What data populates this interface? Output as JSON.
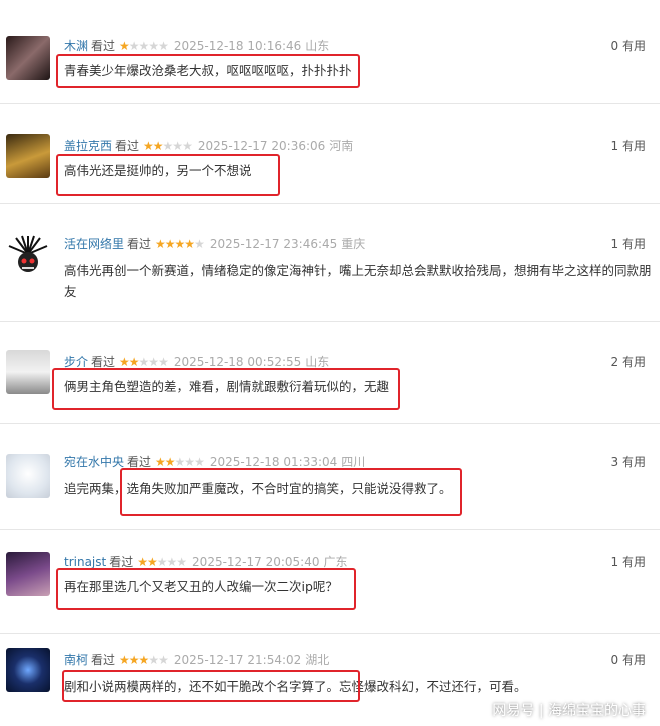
{
  "reviews": [
    {
      "user": "木渊",
      "status": "看过",
      "stars": 1,
      "time": "2025-12-18 10:16:46",
      "location": "山东",
      "useful": "0 有用",
      "content": "青春美少年爆改沧桑老大叔，呕呕呕呕呕，扑扑扑扑"
    },
    {
      "user": "盖拉克西",
      "status": "看过",
      "stars": 2,
      "time": "2025-12-17 20:36:06",
      "location": "河南",
      "useful": "1 有用",
      "content": "高伟光还是挺帅的，另一个不想说"
    },
    {
      "user": "活在网络里",
      "status": "看过",
      "stars": 4,
      "time": "2025-12-17 23:46:45",
      "location": "重庆",
      "useful": "1 有用",
      "content": "高伟光再创一个新赛道，情绪稳定的像定海神针，嘴上无奈却总会默默收拾残局，想拥有毕之这样的同款朋友"
    },
    {
      "user": "步介",
      "status": "看过",
      "stars": 2,
      "time": "2025-12-18 00:52:55",
      "location": "山东",
      "useful": "2 有用",
      "content": "俩男主角色塑造的差，难看，剧情就跟敷衍着玩似的，无趣"
    },
    {
      "user": "宛在水中央",
      "status": "看过",
      "stars": 2,
      "time": "2025-12-18 01:33:04",
      "location": "四川",
      "useful": "3 有用",
      "content": "追完两集，选角失败加严重魔改，不合时宜的搞笑，只能说没得救了。"
    },
    {
      "user": "trinajst",
      "status": "看过",
      "stars": 2,
      "time": "2025-12-17 20:05:40",
      "location": "广东",
      "useful": "1 有用",
      "content": "再在那里选几个又老又丑的人改编一次二次ip呢？"
    },
    {
      "user": "南柯",
      "status": "看过",
      "stars": 3,
      "time": "2025-12-17 21:54:02",
      "location": "湖北",
      "useful": "0 有用",
      "content": "剧和小说两模两样的，还不如干脆改个名字算了。忘怪爆改科幻，不过还行，可看。"
    }
  ],
  "watermark": "网易号 | 海绵宝宝的心事",
  "colors": {
    "highlight": "#e0242b",
    "star_on": "#f5a623",
    "star_off": "#d6d6d6",
    "username": "#3377aa"
  }
}
